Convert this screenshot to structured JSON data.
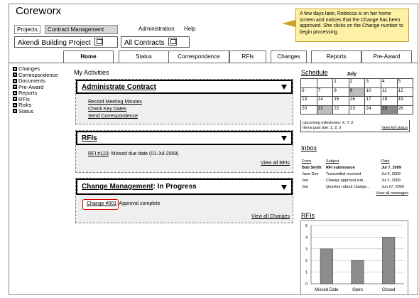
{
  "app_title": "Coreworx",
  "menu": [
    "Projects",
    "Contract Management",
    "Administration",
    "Help"
  ],
  "project_select": "Akendi Building Project",
  "contract_select": "All Contracts",
  "tabs": [
    "Home",
    "Status",
    "Correspondence",
    "RFIs",
    "Changes",
    "Reports",
    "Pre-Award"
  ],
  "sidebar": [
    "Changes",
    "Correspondence",
    "Documents",
    "Pre-Award",
    "Reports",
    "RFIs",
    "Risks",
    "Status"
  ],
  "activities_title": "My Activities",
  "panels": {
    "contract": {
      "title": "Administrate Contract",
      "links": [
        "Record Meeting Minutes",
        "Check Key Dates",
        "Send Correspondence"
      ]
    },
    "rfis": {
      "title": "RFIs",
      "item_link": "RFI #123",
      "item_text": ": Missed due date (01-Jul-2009)",
      "view_all": "View all RFIs"
    },
    "changes": {
      "title_link": "Change Management",
      "title_rest": ": In Progress",
      "item_link": "Change #001",
      "item_text": ": Approval complete",
      "view_all": "View all Changes"
    }
  },
  "note": "A few days later, Rebecca is on her home screen and notices that the Change has been approved. She clicks on the Change number to begin processing.",
  "schedule": {
    "title": "Schedule",
    "month": "July",
    "rows": [
      [
        "",
        "",
        "1",
        "2",
        "3",
        "4",
        "5"
      ],
      [
        "6",
        "7",
        "8",
        "9",
        "10",
        "11",
        "12"
      ],
      [
        "13",
        "14",
        "15",
        "16",
        "17",
        "18",
        "19"
      ],
      [
        "20",
        "21",
        "22",
        "23",
        "24",
        "25",
        "26"
      ]
    ],
    "milestones": "Upcoming milestones: X, Y, Z",
    "past_due": "Items past due: 1, 2, 3",
    "view_full": "View full status"
  },
  "inbox": {
    "title": "Inbox",
    "headers": [
      "From",
      "Subject",
      "Date"
    ],
    "rows": [
      [
        "Bob Smith",
        "RFI submission",
        "Jul 7, 2009"
      ],
      [
        "Jane Doe",
        "Transmittal received",
        "Jul 6, 2009"
      ],
      [
        "Joe",
        "Change approval sub...",
        "Jul 2, 2009"
      ],
      [
        "Joe",
        "Question about change...",
        "Jun 27, 2009"
      ]
    ],
    "view_all": "View all messages"
  },
  "rfis_section_title": "RFIs",
  "chart_data": {
    "type": "bar",
    "categories": [
      "Missed Date",
      "Open",
      "Closed"
    ],
    "values": [
      3,
      2,
      4
    ],
    "ylim": [
      0,
      5
    ],
    "yticks": [
      "0",
      "1",
      "2",
      "3",
      "4",
      "5"
    ],
    "grid": true,
    "bar_color": "#8c8c8c"
  }
}
